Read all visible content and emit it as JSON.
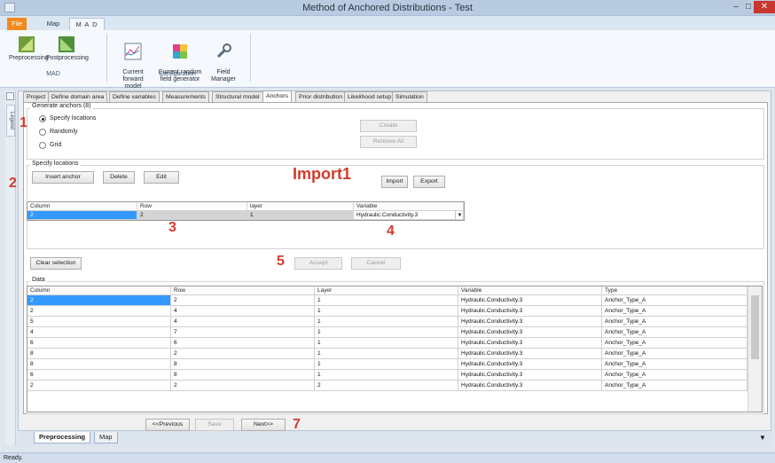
{
  "window": {
    "title": "Method of Anchored Distributions - Test"
  },
  "ribbon_tabs": [
    "File",
    "Map",
    "M A D"
  ],
  "ribbon": {
    "groups": [
      {
        "label": "MAD",
        "buttons": [
          "Preprocessing",
          "Postprocessing"
        ]
      },
      {
        "label": "Configuration",
        "buttons": [
          "Current\nforward model",
          "Current random\nfield generator",
          "Field\nManager"
        ]
      }
    ]
  },
  "legend_tab": "Legend",
  "tabs": [
    "Project",
    "Define domain area",
    "Define variables",
    "Measurements",
    "Structural model",
    "Anchors",
    "Prior distribution",
    "Likelihood setup",
    "Simulation"
  ],
  "active_tab": "Anchors",
  "generate": {
    "title": "Generate anchors (8)",
    "options": [
      "Specify locations",
      "Randomly",
      "Grid"
    ],
    "selected": "Specify locations",
    "create_label": "Create",
    "remove_all_label": "Remove All"
  },
  "specify": {
    "title": "Specify locations",
    "insert_label": "Insert anchor",
    "delete_label": "Delete",
    "edit_label": "Edit",
    "import_label": "Import",
    "export_label": "Export",
    "columns": [
      "Column",
      "Row",
      "layer",
      "Variable"
    ],
    "row": [
      "2",
      "2",
      "1",
      "Hydraulic.Conductivity.3"
    ]
  },
  "clear_label": "Clear selection",
  "accept_label": "Accept",
  "cancel_label": "Cancel",
  "data": {
    "title": "Data",
    "columns": [
      "Column",
      "Row",
      "Layer",
      "Variable",
      "Type"
    ],
    "rows": [
      [
        "2",
        "2",
        "1",
        "Hydraulic.Conductivity.3",
        "Anchor_Type_A"
      ],
      [
        "2",
        "4",
        "1",
        "Hydraulic.Conductivity.3",
        "Anchor_Type_A"
      ],
      [
        "5",
        "4",
        "1",
        "Hydraulic.Conductivity.3",
        "Anchor_Type_A"
      ],
      [
        "4",
        "7",
        "1",
        "Hydraulic.Conductivity.3",
        "Anchor_Type_A"
      ],
      [
        "6",
        "6",
        "1",
        "Hydraulic.Conductivity.3",
        "Anchor_Type_A"
      ],
      [
        "8",
        "2",
        "1",
        "Hydraulic.Conductivity.3",
        "Anchor_Type_A"
      ],
      [
        "8",
        "8",
        "1",
        "Hydraulic.Conductivity.3",
        "Anchor_Type_A"
      ],
      [
        "6",
        "8",
        "1",
        "Hydraulic.Conductivity.3",
        "Anchor_Type_A"
      ],
      [
        "2",
        "2",
        "2",
        "Hydraulic.Conductivity.3",
        "Anchor_Type_A"
      ]
    ]
  },
  "nav": {
    "previous_label": "<<Previous",
    "save_label": "Save",
    "next_label": "Next>>"
  },
  "bottom_tabs": [
    "Preprocessing",
    "Map"
  ],
  "status": "Ready.",
  "annotations": [
    "1",
    "2",
    "3",
    "4",
    "5",
    "Import1",
    "7"
  ],
  "colors": {
    "accent": "#3399ff",
    "file_tab": "#f18a1d",
    "annotation": "#d23a2e",
    "close": "#c9362e"
  }
}
